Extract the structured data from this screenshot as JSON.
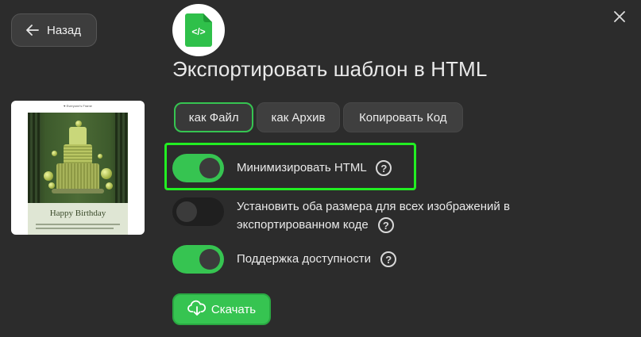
{
  "header": {
    "back_label": "Назад",
    "title": "Экспортировать шаблон в HTML",
    "file_icon_glyph": "</>"
  },
  "thumbnail": {
    "header_text": "♥ Everyone's Frame",
    "caption": "Happy Birthday"
  },
  "tabs": [
    {
      "label": "как Файл",
      "active": true
    },
    {
      "label": "как Архив",
      "active": false
    },
    {
      "label": "Копировать Код",
      "active": false
    }
  ],
  "options": [
    {
      "label": "Минимизировать HTML",
      "enabled": true
    },
    {
      "label_line1": "Установить оба размера для всех изображений в",
      "label_line2": "экспортированном коде",
      "enabled": false
    },
    {
      "label": "Поддержка доступности",
      "enabled": true
    }
  ],
  "download": {
    "label": "Скачать"
  },
  "colors": {
    "background": "#2c2c2c",
    "accent": "#36c451",
    "highlight": "#22ee22",
    "button_bg": "#3d3d3d"
  },
  "icons": {
    "back": "arrow-left-icon",
    "close": "close-icon",
    "file": "code-file-icon",
    "help": "question-circle-icon",
    "download": "cloud-download-icon"
  }
}
